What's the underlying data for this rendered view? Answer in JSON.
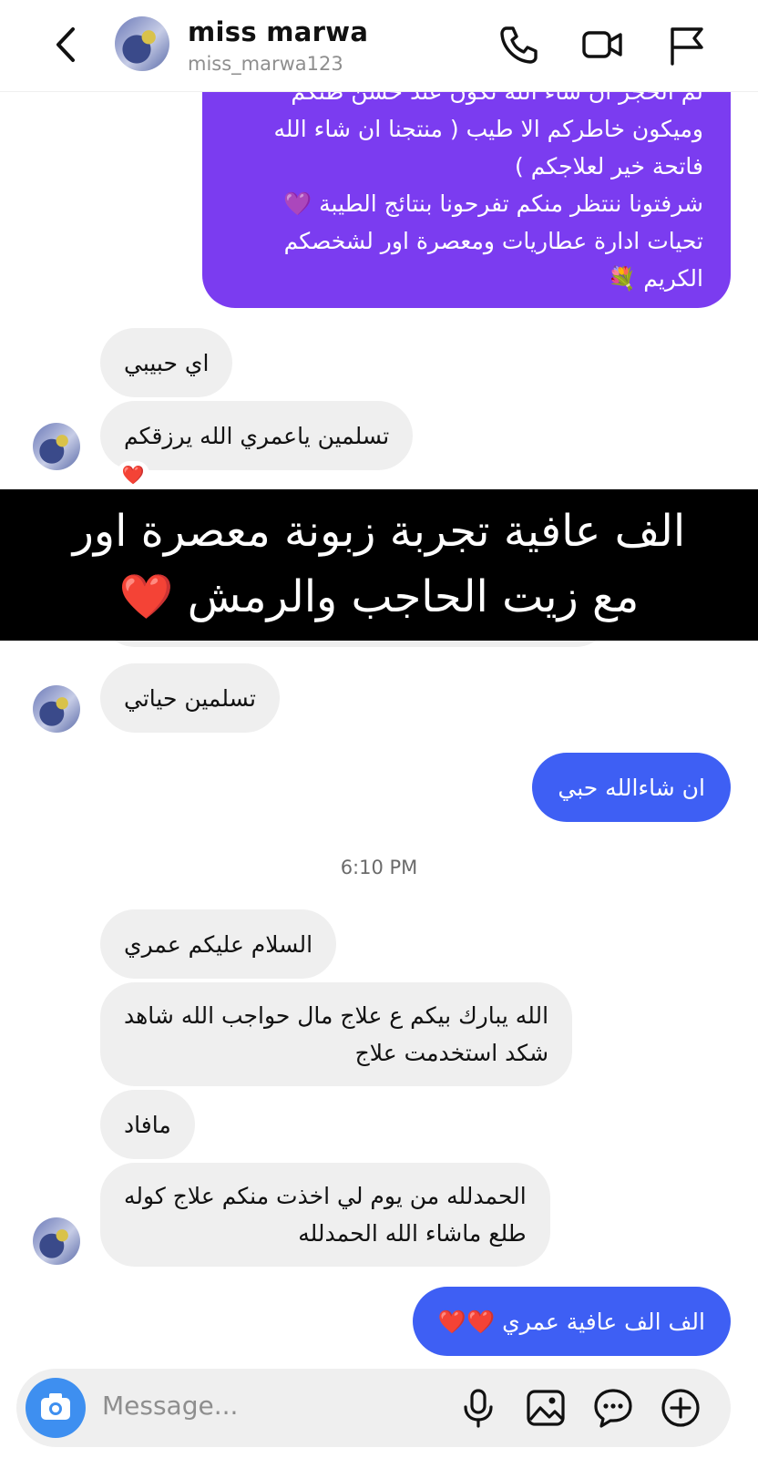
{
  "header": {
    "display_name": "miss marwa",
    "username": "miss_marwa123",
    "icons": [
      "back-chevron-icon",
      "phone-icon",
      "video-icon",
      "flag-icon"
    ]
  },
  "messages": {
    "purple_lines": [
      "لم الحجز ان شاء الله تكون عند حسن ظنكم",
      "وميكون خاطركم الا طيب ( منتجنا ان شاء الله",
      "فاتحة خير لعلاجكم )",
      "شرفتونا ننتظر منكم تفرحونا  بنتائج الطيبة 💜",
      "تحيات ادارة عطاريات ومعصرة اور لشخصكم",
      "الكريم 💐"
    ],
    "in_1": "اي حبيبي",
    "in_2": "تسلمين ياعمري الله يرزقكم",
    "reaction": "❤️",
    "in_3": "تسلمين حياتي",
    "out_1": "ان شاءالله حبي",
    "timestamp": "6:10 PM",
    "in_4": "السلام عليكم عمري",
    "in_5_lines": [
      "الله يبارك بيكم ع علاج مال حواجب الله شاهد",
      "شكد استخدمت علاج"
    ],
    "in_6": "مافاد",
    "in_7_lines": [
      "الحمدلله من يوم لي اخذت منكم علاج كوله",
      "طلع ماشاء الله الحمدلله"
    ],
    "out_2": "الف الف عافية عمري ❤️❤️"
  },
  "overlay": {
    "line1": "الف عافية تجربة زبونة معصرة اور",
    "line2": "مع زيت الحاجب والرمش",
    "heart": "❤️"
  },
  "composer": {
    "placeholder": "Message...",
    "icons": [
      "camera-icon",
      "microphone-icon",
      "gallery-icon",
      "sticker-icon",
      "add-icon"
    ]
  },
  "colors": {
    "outgoing_bubble": "#3e5ff4",
    "purple_bubble": "#7b3cf0",
    "incoming_bubble": "#efefef",
    "overlay_band": "#000000"
  }
}
